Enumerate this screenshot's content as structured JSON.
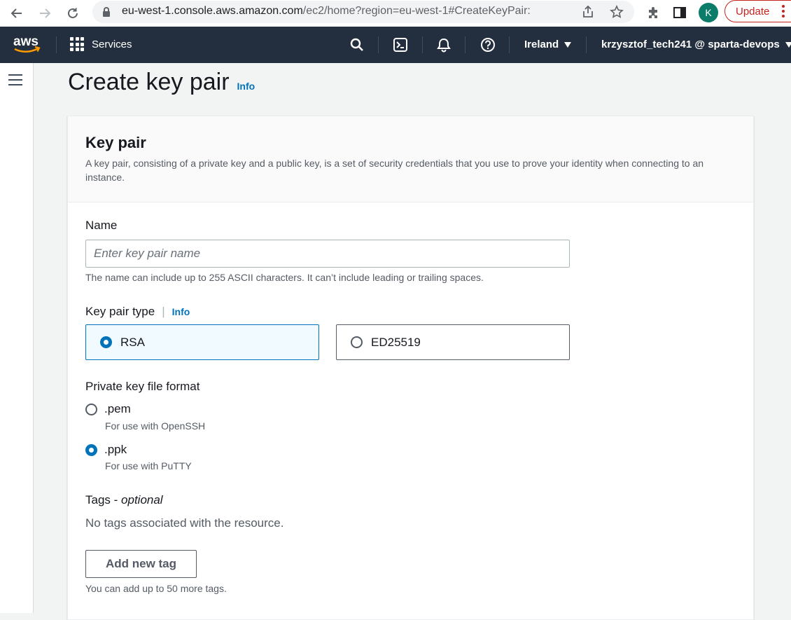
{
  "browser": {
    "url_host": "eu-west-1.console.aws.amazon.com",
    "url_path": "/ec2/home?region=eu-west-1#CreateKeyPair:",
    "profile_initial": "K",
    "update_label": "Update"
  },
  "topnav": {
    "logo_text": "aws",
    "services_label": "Services",
    "region_label": "Ireland",
    "account_label": "krzysztof_tech241 @ sparta-devops"
  },
  "page": {
    "title": "Create key pair",
    "title_info": "Info"
  },
  "panel": {
    "title": "Key pair",
    "description": "A key pair, consisting of a private key and a public key, is a set of security credentials that you use to prove your identity when connecting to an instance."
  },
  "name_field": {
    "label": "Name",
    "placeholder": "Enter key pair name",
    "value": "",
    "hint": "The name can include up to 255 ASCII characters. It can’t include leading or trailing spaces."
  },
  "key_type": {
    "label": "Key pair type",
    "info": "Info",
    "options": [
      {
        "label": "RSA",
        "selected": true
      },
      {
        "label": "ED25519",
        "selected": false
      }
    ]
  },
  "file_format": {
    "label": "Private key file format",
    "options": [
      {
        "label": ".pem",
        "description": "For use with OpenSSH",
        "selected": false
      },
      {
        "label": ".ppk",
        "description": "For use with PuTTY",
        "selected": true
      }
    ]
  },
  "tags": {
    "label": "Tags - ",
    "label_optional": "optional",
    "empty_text": "No tags associated with the resource.",
    "add_button": "Add new tag",
    "limit_hint": "You can add up to 50 more tags."
  },
  "colors": {
    "accent": "#0073bb",
    "nav_bg": "#232f3e",
    "aws_orange": "#ff9900"
  }
}
